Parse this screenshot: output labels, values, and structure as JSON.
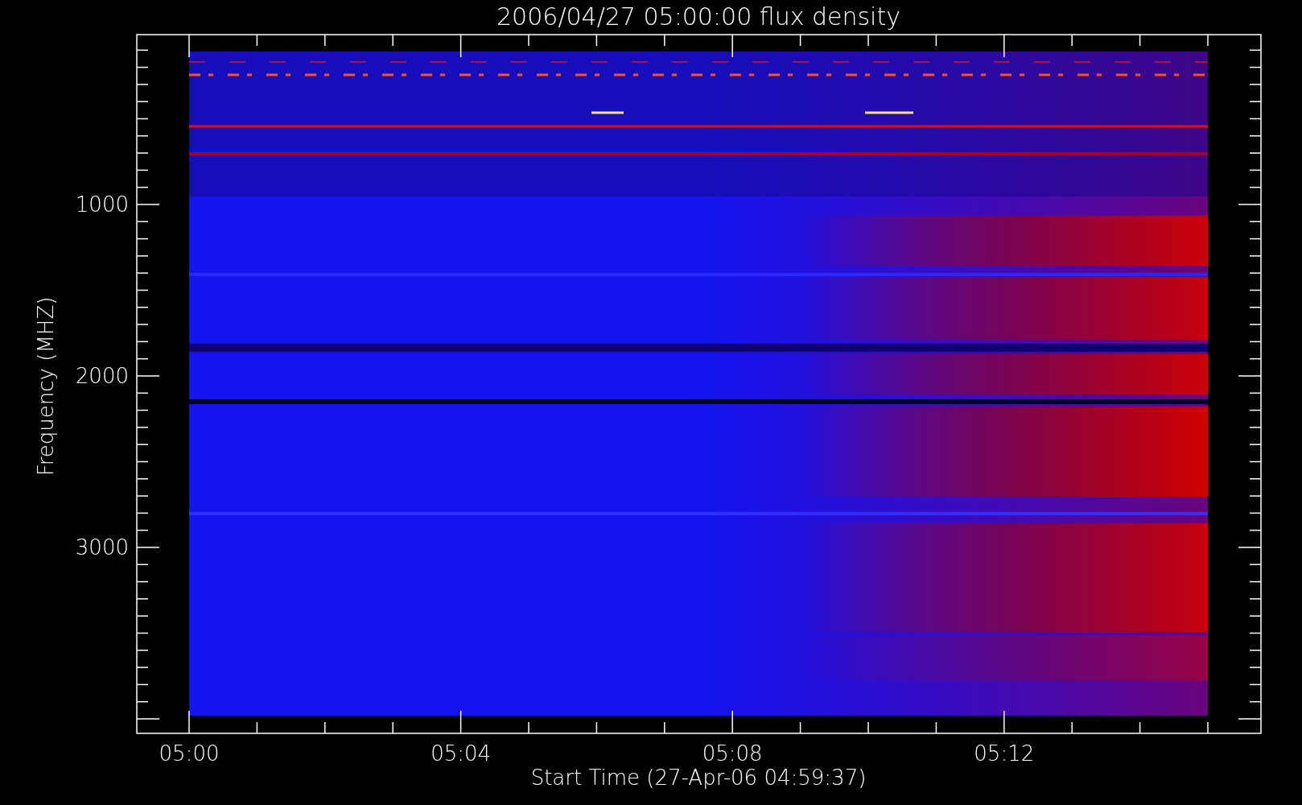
{
  "title": "2006/04/27 05:00:00 flux density",
  "y_axis": {
    "label": "Frequency (MHZ)",
    "ticks": [
      "1000",
      "2000",
      "3000"
    ]
  },
  "x_axis": {
    "label": "Start Time (27-Apr-06 04:59:37)",
    "ticks": [
      "05:00",
      "05:04",
      "05:08",
      "05:12"
    ]
  }
}
